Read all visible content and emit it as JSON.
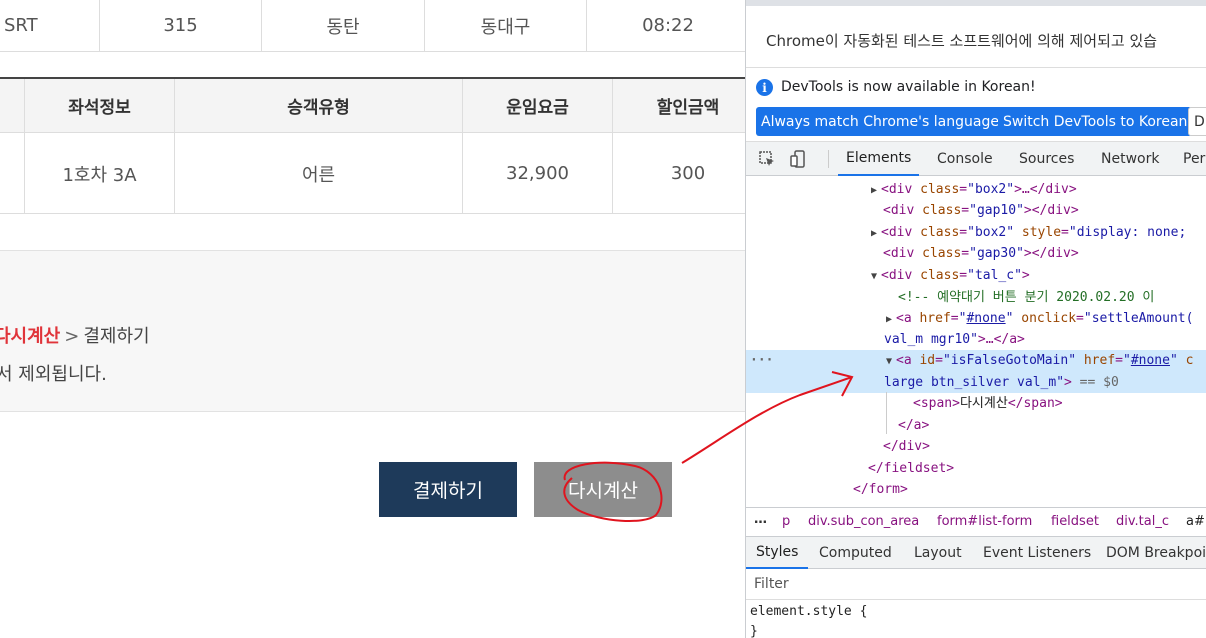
{
  "train_row": {
    "type": "SRT",
    "train_no": "315",
    "dep": "동탄",
    "arr": "동대구",
    "time": "08:22"
  },
  "fare_table": {
    "headers": [
      "좌석정보",
      "승객유형",
      "운임요금",
      "할인금액"
    ],
    "row": [
      "1호차 3A",
      "어른",
      "32,900",
      "300"
    ]
  },
  "steps": {
    "current": "다시계산",
    "separator": ">",
    "next": "결제하기"
  },
  "notice": "서 제외됩니다.",
  "buttons": {
    "pay": "결제하기",
    "recalc": "다시계산"
  },
  "devtools": {
    "infobar": "Chrome이 자동화된 테스트 소프트웨어에 의해 제어되고 있습",
    "lang_message": "DevTools is now available in Korean!",
    "lang_btn_match": "Always match Chrome's language",
    "lang_btn_switch": "Switch DevTools to Korean",
    "lang_btn_more": "D",
    "tabs": [
      "Elements",
      "Console",
      "Sources",
      "Network",
      "Per"
    ],
    "breadcrumbs": [
      "…",
      "p",
      "div.sub_con_area",
      "form#list-form",
      "fieldset",
      "div.tal_c",
      "a#i"
    ],
    "style_tabs": [
      "Styles",
      "Computed",
      "Layout",
      "Event Listeners",
      "DOM Breakpoi"
    ],
    "filter_placeholder": "Filter",
    "element_style": "element.style {",
    "element_style_close": "}",
    "dom": {
      "l1_class": "box2",
      "l2_class": "gap10",
      "l3_class": "box2",
      "l3_style": "display: none",
      "l4_class": "gap30",
      "l5_class": "tal_c",
      "comment": "<!-- 예약대기 버튼 분기  2020.02.20 이",
      "a1_href": "#none",
      "a1_onclick": "settleAmount(",
      "a1_class_cont": "val_m mgr10",
      "a2_id": "isFalseGotoMain",
      "a2_href": "#none",
      "a2_attr_tail": "c",
      "a2_class_cont": "large  btn_silver val_m",
      "a2_eq": "== $0",
      "span_text": "다시계산"
    }
  }
}
